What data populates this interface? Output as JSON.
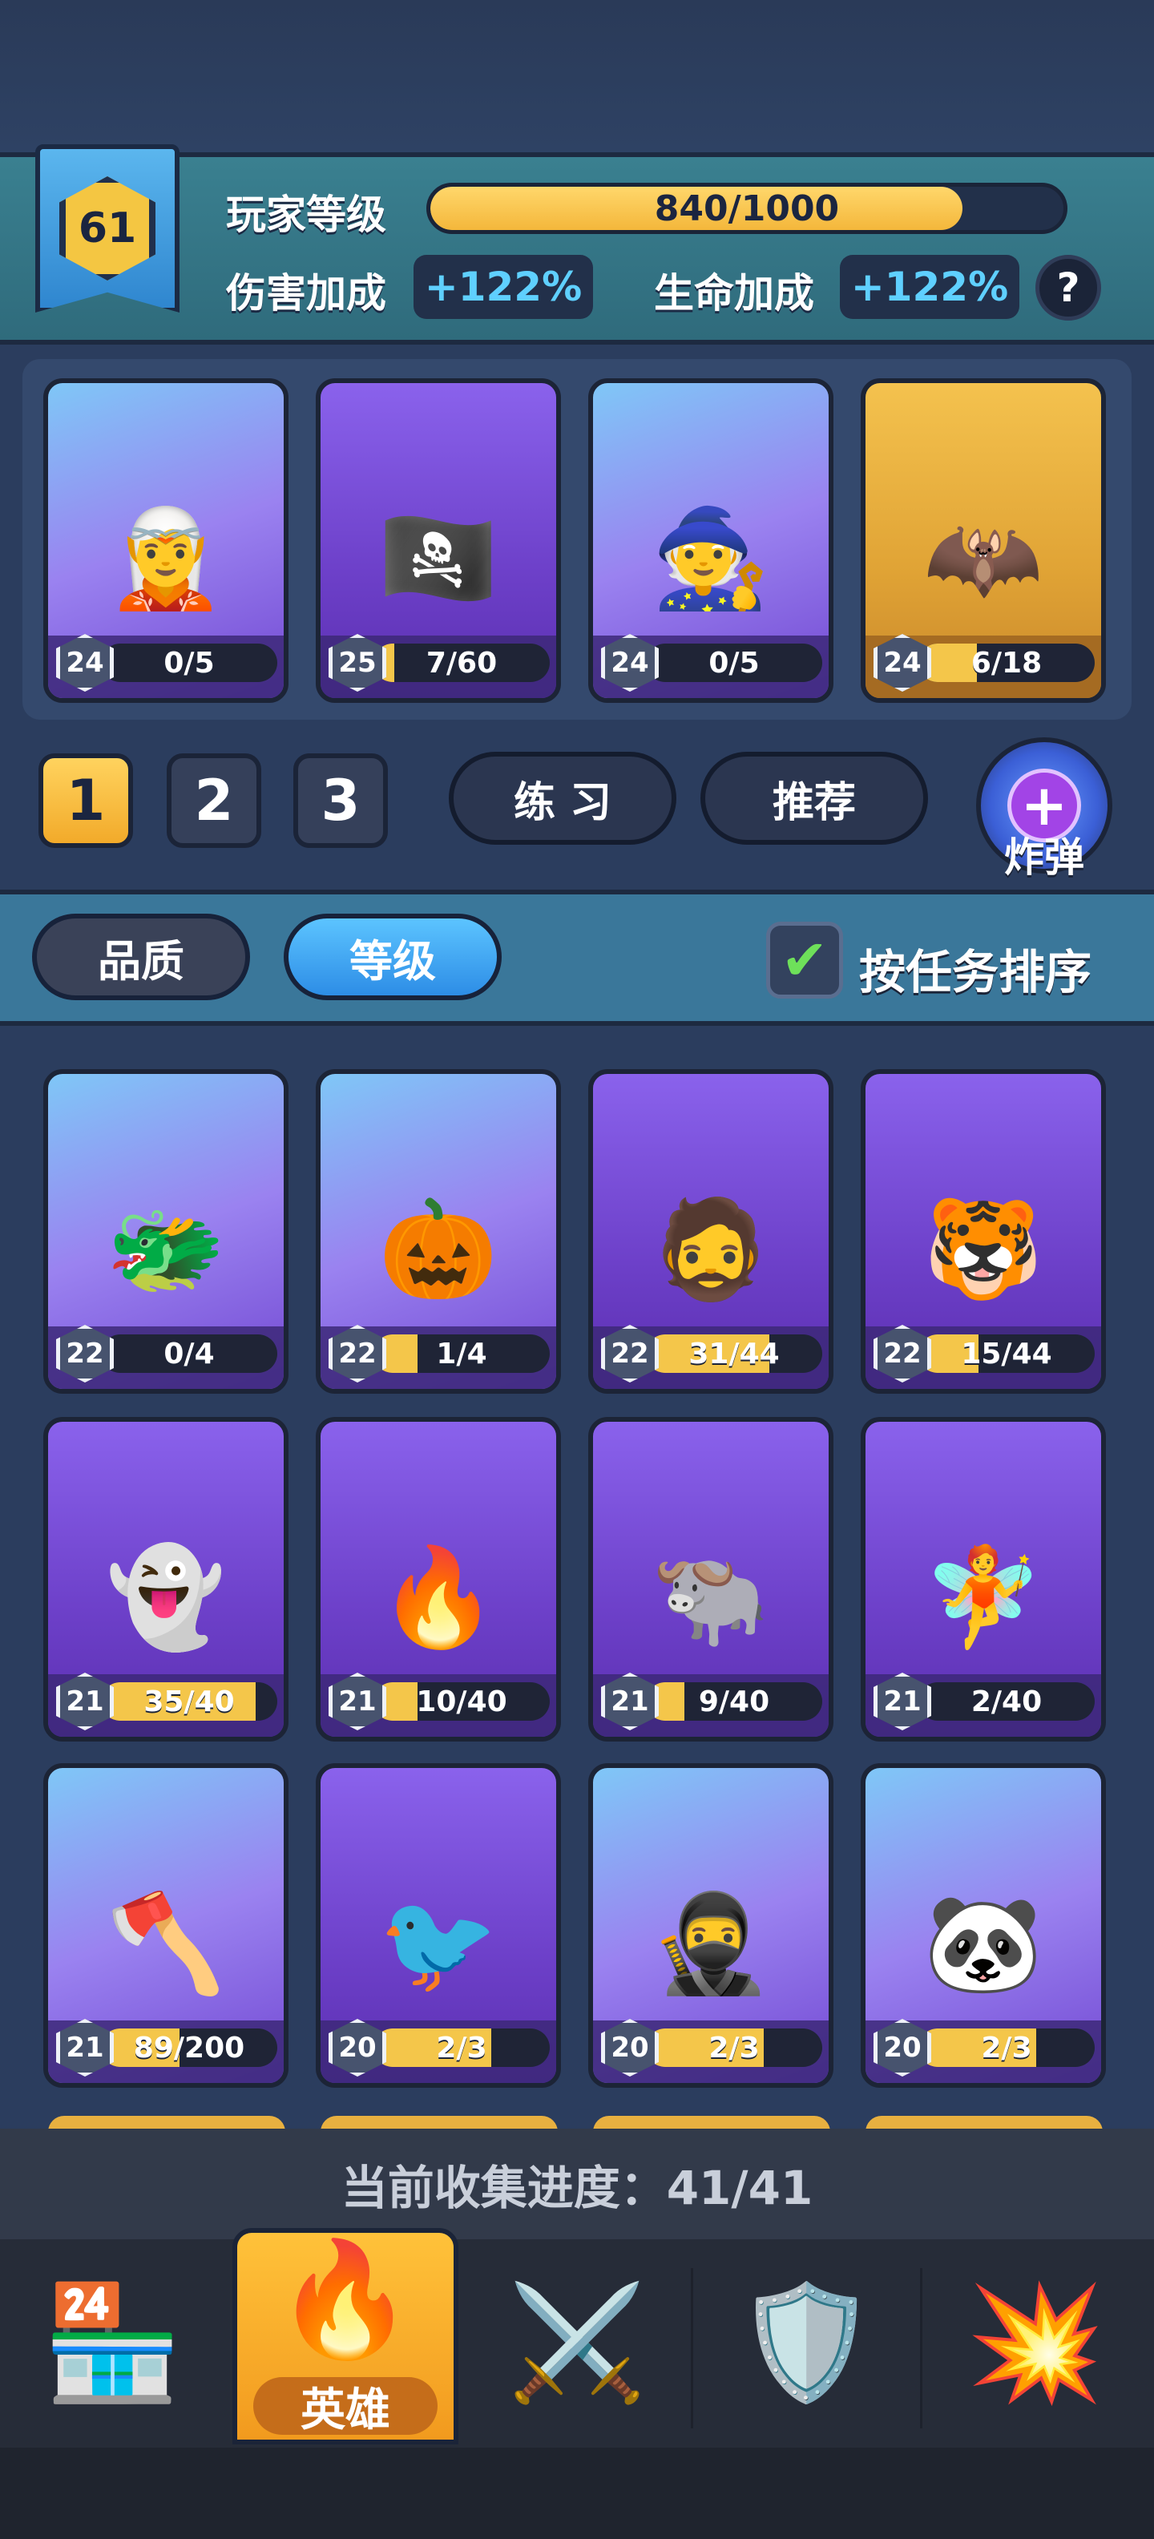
{
  "player": {
    "level": "61",
    "level_label": "玩家等级",
    "xp_text": "840/1000",
    "xp_fraction": 0.84,
    "damage_label": "伤害加成",
    "damage_value": "+122%",
    "health_label": "生命加成",
    "health_value": "+122%",
    "help": "?"
  },
  "team": [
    {
      "level": "24",
      "progress": "0/5",
      "fill": 0.0,
      "bg": "blue",
      "icon": "🧝"
    },
    {
      "level": "25",
      "progress": "7/60",
      "fill": 0.12,
      "bg": "purple",
      "icon": "🏴‍☠️"
    },
    {
      "level": "24",
      "progress": "0/5",
      "fill": 0.0,
      "bg": "blue",
      "icon": "🧙"
    },
    {
      "level": "24",
      "progress": "6/18",
      "fill": 0.33,
      "bg": "gold",
      "icon": "🦇"
    }
  ],
  "deck_tabs": [
    "1",
    "2",
    "3"
  ],
  "buttons": {
    "practice": "练 习",
    "recommend": "推荐",
    "bomb": "炸弹"
  },
  "sort": {
    "quality": "品质",
    "level": "等级",
    "by_task": "按任务排序"
  },
  "heroes": [
    {
      "level": "22",
      "progress": "0/4",
      "fill": 0.0,
      "bg": "blue",
      "icon": "🐲"
    },
    {
      "level": "22",
      "progress": "1/4",
      "fill": 0.25,
      "bg": "blue",
      "icon": "🎃"
    },
    {
      "level": "22",
      "progress": "31/44",
      "fill": 0.7,
      "bg": "purple",
      "icon": "🧔"
    },
    {
      "level": "22",
      "progress": "15/44",
      "fill": 0.34,
      "bg": "purple",
      "icon": "🐯"
    },
    {
      "level": "21",
      "progress": "35/40",
      "fill": 0.875,
      "bg": "purple",
      "icon": "👻"
    },
    {
      "level": "21",
      "progress": "10/40",
      "fill": 0.25,
      "bg": "purple",
      "icon": "🔥"
    },
    {
      "level": "21",
      "progress": "9/40",
      "fill": 0.22,
      "bg": "purple",
      "icon": "🐃"
    },
    {
      "level": "21",
      "progress": "2/40",
      "fill": 0.05,
      "bg": "purple",
      "icon": "🧚"
    },
    {
      "level": "21",
      "progress": "89/200",
      "fill": 0.445,
      "bg": "blue",
      "icon": "🪓"
    },
    {
      "level": "20",
      "progress": "2/3",
      "fill": 0.67,
      "bg": "purple",
      "icon": "🐦"
    },
    {
      "level": "20",
      "progress": "2/3",
      "fill": 0.67,
      "bg": "blue",
      "icon": "🥷"
    },
    {
      "level": "20",
      "progress": "2/3",
      "fill": 0.67,
      "bg": "blue",
      "icon": "🐼"
    }
  ],
  "collection": "当前收集进度：41/41",
  "nav": [
    {
      "name": "shop",
      "icon": "🏪"
    },
    {
      "name": "hero",
      "icon": "🔥",
      "label": "英雄",
      "active": true
    },
    {
      "name": "battle",
      "icon": "⚔️"
    },
    {
      "name": "clan",
      "icon": "🛡️"
    },
    {
      "name": "event",
      "icon": "💥"
    }
  ]
}
